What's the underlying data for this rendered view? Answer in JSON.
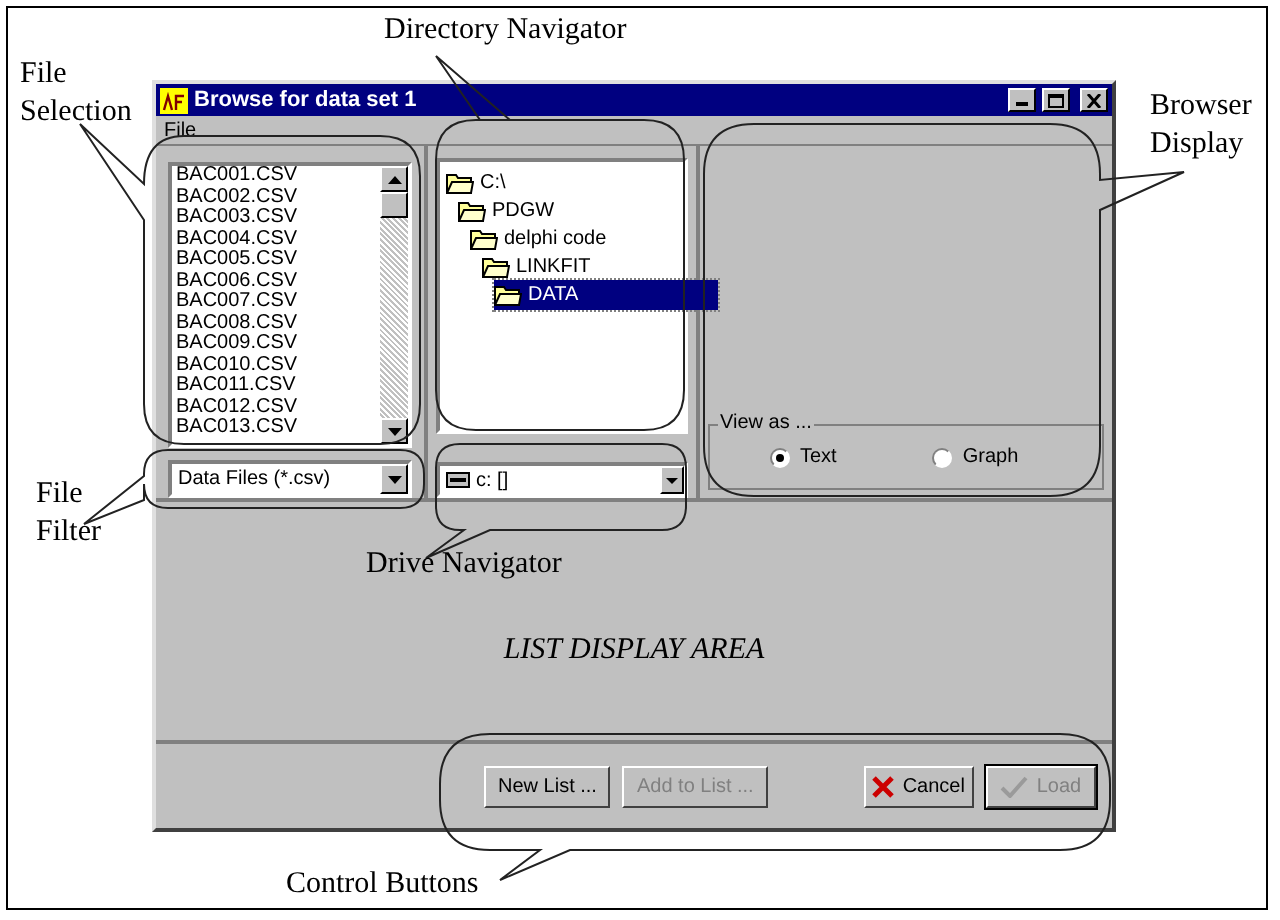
{
  "window": {
    "title": "Browse for data set 1"
  },
  "menu": [
    "File"
  ],
  "files": [
    {
      "name": "BAC001.CSV",
      "selected": false
    },
    {
      "name": "BAC002.CSV",
      "selected": false
    },
    {
      "name": "BAC003.CSV",
      "selected": false
    },
    {
      "name": "BAC004.CSV",
      "selected": false
    },
    {
      "name": "BAC005.CSV",
      "selected": false
    },
    {
      "name": "BAC006.CSV",
      "selected": false
    },
    {
      "name": "BAC007.CSV",
      "selected": false
    },
    {
      "name": "BAC008.CSV",
      "selected": false
    },
    {
      "name": "BAC009.CSV",
      "selected": false
    },
    {
      "name": "BAC010.CSV",
      "selected": false
    },
    {
      "name": "BAC011.CSV",
      "selected": false
    },
    {
      "name": "BAC012.CSV",
      "selected": false
    },
    {
      "name": "BAC013.CSV",
      "selected": false
    }
  ],
  "filter": "Data Files (*.csv)",
  "directories": [
    {
      "label": "C:\\",
      "selected": false,
      "children": [
        {
          "label": "PDGW",
          "selected": false,
          "children": [
            {
              "label": "delphi code",
              "selected": false,
              "children": [
                {
                  "label": "LINKFIT",
                  "selected": false,
                  "children": [
                    {
                      "label": "DATA",
                      "selected": true
                    }
                  ]
                }
              ]
            }
          ]
        }
      ]
    }
  ],
  "drive": "c: []",
  "view_as": {
    "label": "View as ...",
    "options": [
      {
        "label": "Text",
        "selected": true
      },
      {
        "label": "Graph",
        "selected": false
      }
    ]
  },
  "list_area_label": "LIST DISPLAY AREA",
  "buttons": [
    {
      "label": "New List ...",
      "kind": "plain",
      "disabled": false
    },
    {
      "label": "Add to List ...",
      "kind": "plain",
      "disabled": true
    },
    {
      "label": "Cancel",
      "kind": "cancel",
      "disabled": false
    },
    {
      "label": "Load",
      "kind": "load",
      "disabled": true
    }
  ],
  "annotations": [
    {
      "text": "File Selection"
    },
    {
      "text": "Directory Navigator"
    },
    {
      "text": "Browser Display"
    },
    {
      "text": "File Filter"
    },
    {
      "text": "Drive Navigator"
    },
    {
      "text": "Control Buttons"
    }
  ]
}
